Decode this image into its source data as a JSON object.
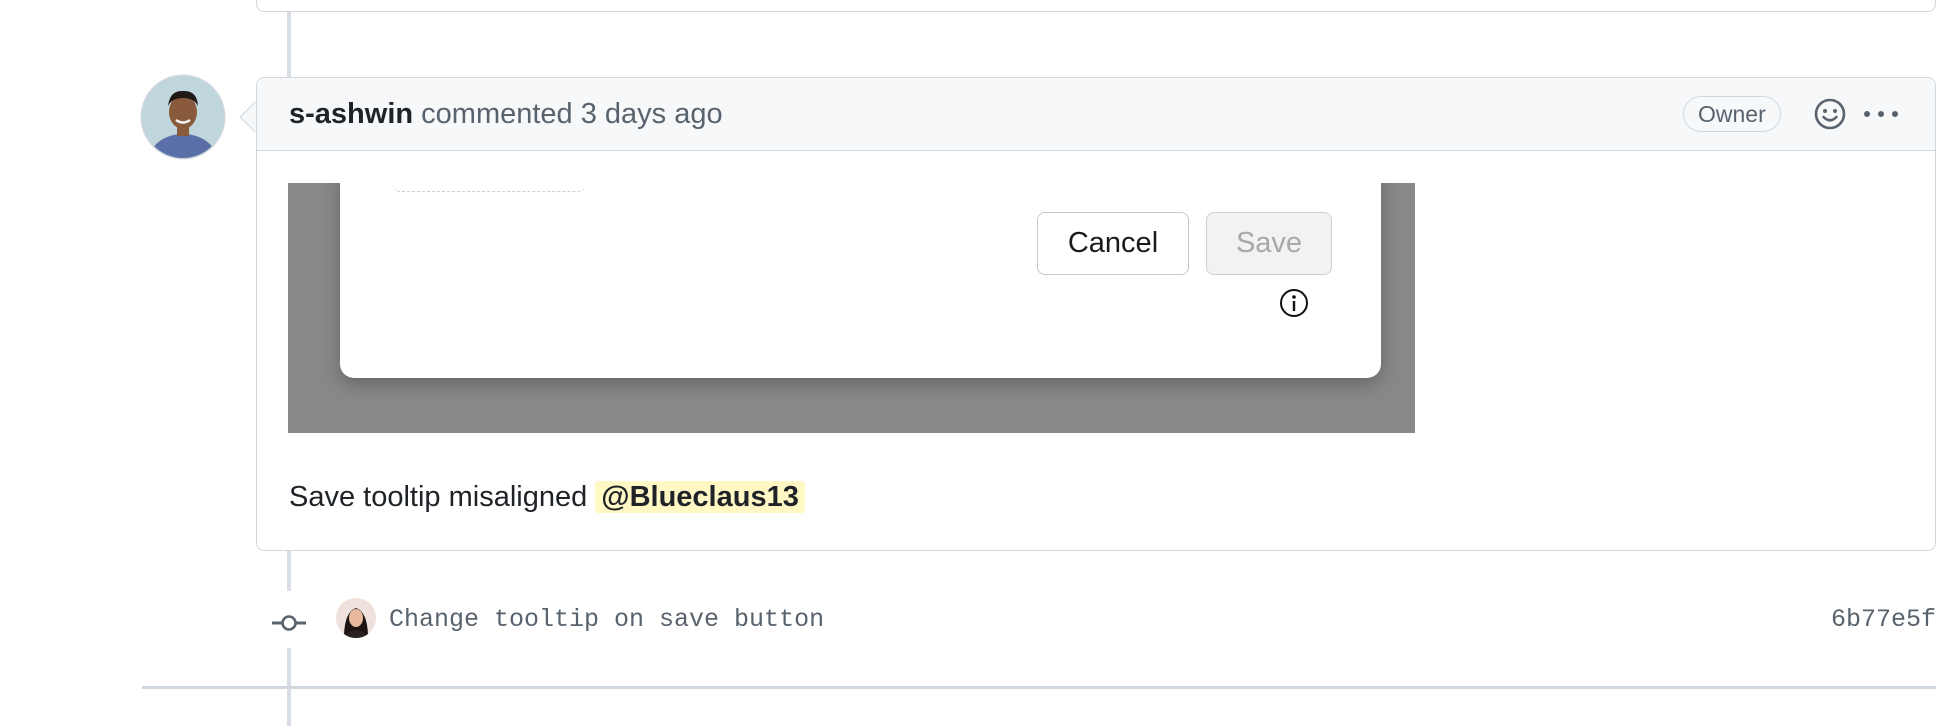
{
  "comment": {
    "author": "s-ashwin",
    "action": "commented",
    "time": "3 days ago",
    "badge": "Owner",
    "body_text": "Save tooltip misaligned",
    "mention": "@Blueclaus13",
    "attachment": {
      "cancel_label": "Cancel",
      "save_label": "Save"
    }
  },
  "commit": {
    "message": "Change tooltip on save button",
    "sha": "6b77e5f"
  },
  "icons": {
    "emoji": "smiley-icon",
    "more": "kebab-horizontal-icon",
    "info": "info-circle-icon",
    "commit": "git-commit-icon"
  },
  "colors": {
    "header_bg": "#f6f8fa",
    "border": "#d0d7de",
    "mention_bg": "#fff8c5",
    "muted_text": "#59636e"
  }
}
